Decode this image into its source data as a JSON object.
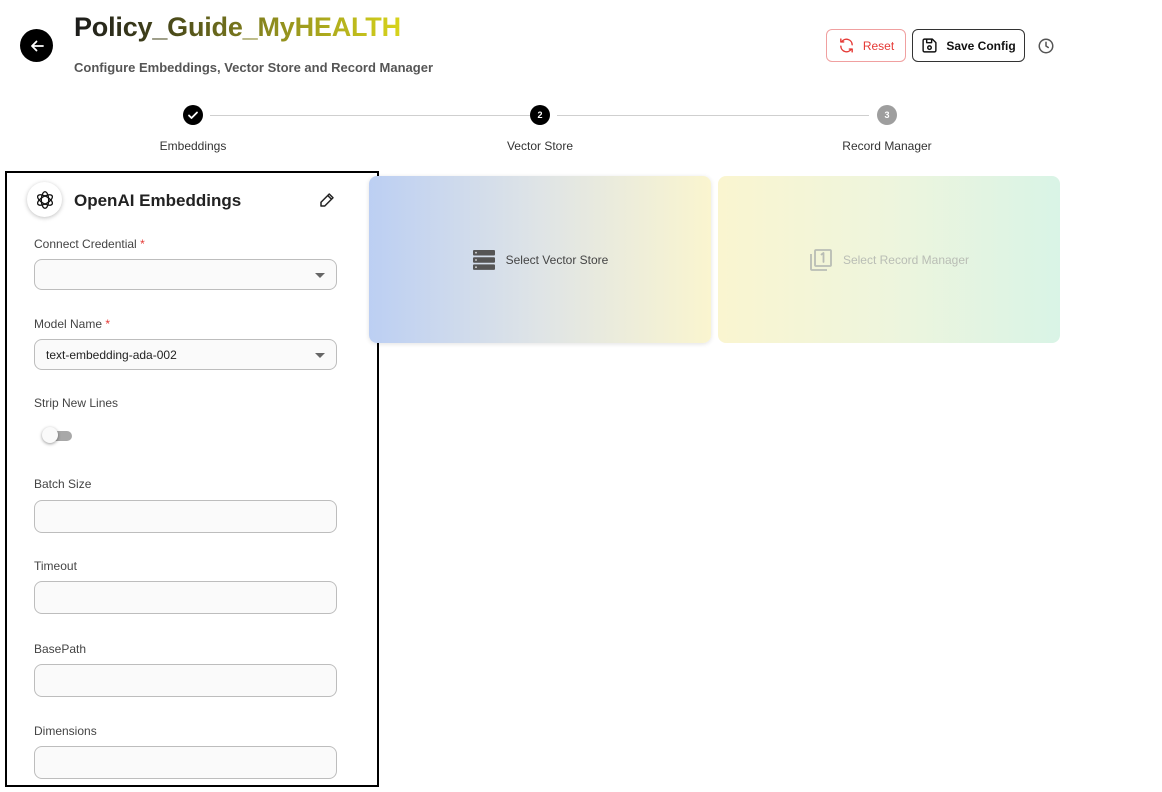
{
  "header": {
    "title": "Policy_Guide_MyHEALTH",
    "subtitle": "Configure Embeddings, Vector Store and Record Manager",
    "reset_label": "Reset",
    "save_label": "Save Config"
  },
  "stepper": {
    "steps": [
      {
        "label": "Embeddings",
        "number": "",
        "status": "completed"
      },
      {
        "label": "Vector Store",
        "number": "2",
        "status": "active"
      },
      {
        "label": "Record Manager",
        "number": "3",
        "status": "pending"
      }
    ]
  },
  "embeddings_panel": {
    "title": "OpenAI Embeddings",
    "fields": {
      "credential": {
        "label": "Connect Credential",
        "required": "*",
        "value": ""
      },
      "model_name": {
        "label": "Model Name",
        "required": "*",
        "value": "text-embedding-ada-002"
      },
      "strip_new_lines": {
        "label": "Strip New Lines",
        "enabled": false
      },
      "batch_size": {
        "label": "Batch Size",
        "value": ""
      },
      "timeout": {
        "label": "Timeout",
        "value": ""
      },
      "base_path": {
        "label": "BasePath",
        "value": ""
      },
      "dimensions": {
        "label": "Dimensions",
        "value": ""
      }
    }
  },
  "cards": {
    "vector_store": {
      "label": "Select Vector Store"
    },
    "record_manager": {
      "label": "Select Record Manager"
    }
  },
  "colors": {
    "step_active": "#000000",
    "step_pending": "#9e9e9e",
    "reset": "#e53935",
    "required": "#e53935"
  },
  "icons": {
    "back": "arrow-left-icon",
    "reset": "refresh-icon",
    "save": "floppy-disk-icon",
    "history": "clock-icon",
    "openai": "openai-logo-icon",
    "edit": "pencil-icon",
    "vector_store": "database-stack-icon",
    "record_manager": "filter-1-icon"
  }
}
